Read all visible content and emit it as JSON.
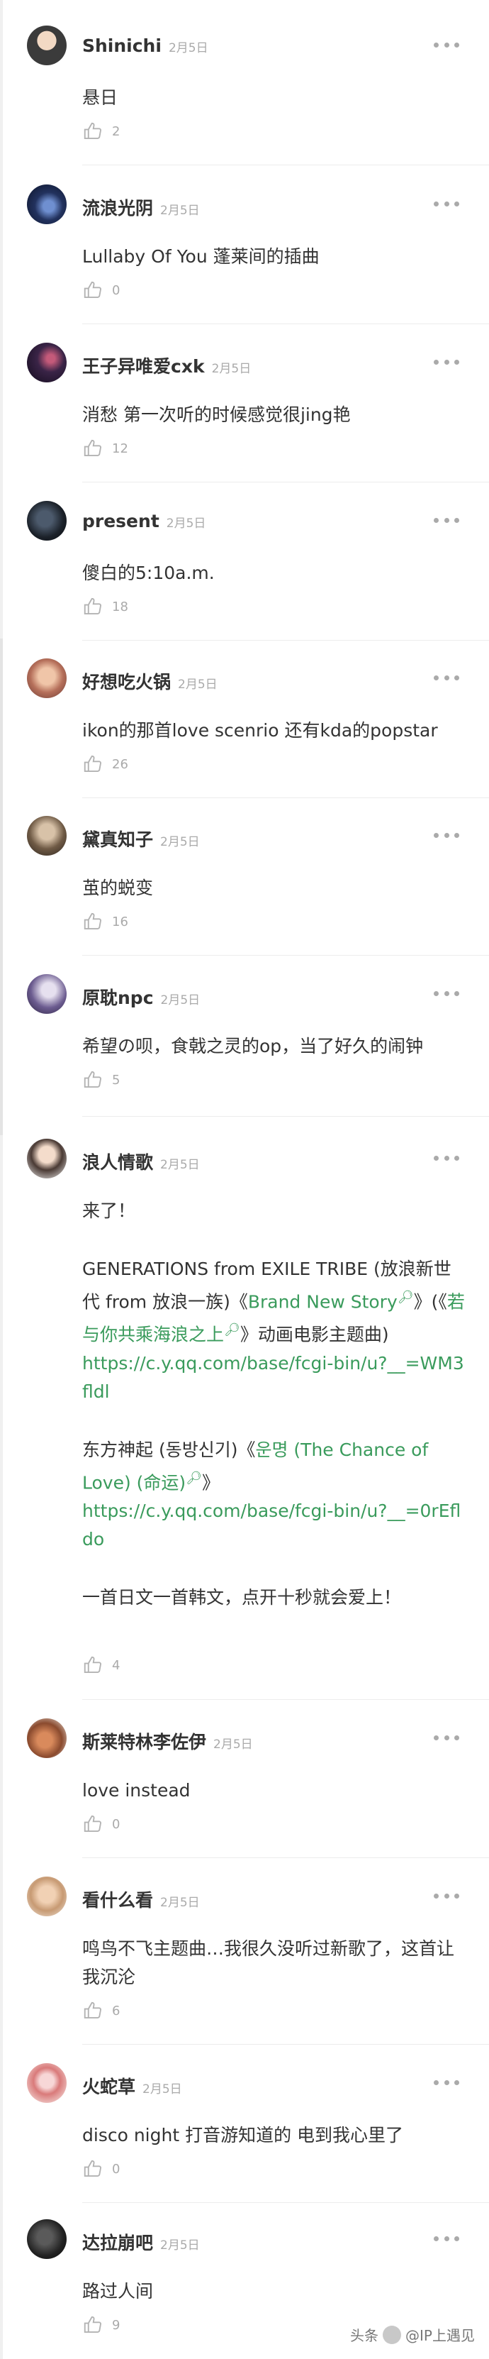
{
  "comments": [
    {
      "user": "Shinichi",
      "date": "2月5日",
      "text": [
        "悬日"
      ],
      "likes": "2"
    },
    {
      "user": "流浪光阴",
      "date": "2月5日",
      "text": [
        "Lullaby Of You  蓬莱间的插曲"
      ],
      "likes": "0"
    },
    {
      "user": "王子异唯爱cxk",
      "date": "2月5日",
      "text": [
        "消愁 第一次听的时候感觉很jing艳"
      ],
      "likes": "12"
    },
    {
      "user": "present",
      "date": "2月5日",
      "text": [
        "傻白的5:10a.m."
      ],
      "likes": "18"
    },
    {
      "user": "好想吃火锅",
      "date": "2月5日",
      "text": [
        "ikon的那首love scenrio  还有kda的popstar"
      ],
      "likes": "26"
    },
    {
      "user": "黛真知子",
      "date": "2月5日",
      "text": [
        "茧的蜕变"
      ],
      "likes": "16"
    },
    {
      "user": "原耽npc",
      "date": "2月5日",
      "text": [
        "希望の呗，食戟之灵的op，当了好久的闹钟"
      ],
      "likes": "5"
    },
    {
      "user": "浪人情歌",
      "date": "2月5日",
      "text": [],
      "likes": "4"
    },
    {
      "user": "斯莱特林李佐伊",
      "date": "2月5日",
      "text": [
        "love instead"
      ],
      "likes": "0"
    },
    {
      "user": "看什么看",
      "date": "2月5日",
      "text": [
        "鸣鸟不飞主题曲…我很久没听过新歌了，这首让我沉沦"
      ],
      "likes": "6"
    },
    {
      "user": "火蛇草",
      "date": "2月5日",
      "text": [
        "disco night 打音游知道的 电到我心里了"
      ],
      "likes": "0"
    },
    {
      "user": "达拉崩吧",
      "date": "2月5日",
      "text": [
        "路过人间"
      ],
      "likes": "9"
    }
  ],
  "rich": {
    "line1": "来了！",
    "p2_pre": "GENERATIONS from EXILE TRIBE (放浪新世代 from 放浪一族)《",
    "p2_song": "Brand New Story",
    "p2_mid": "》(《",
    "p2_anime": "若与你共乘海浪之上",
    "p2_post": "》动画电影主题曲)",
    "p2_url": "https://c.y.qq.com/base/fcgi-bin/u?__=WM3fldl",
    "p3_pre": "东方神起 (동방신기)《",
    "p3_song": "운명 (The Chance of Love) (命运)",
    "p3_post": "》",
    "p3_url": "https://c.y.qq.com/base/fcgi-bin/u?__=0rEfldo",
    "p4": "一首日文一首韩文，点开十秒就会爱上！"
  },
  "watermark": {
    "left": "头条",
    "right": "@IP上遇见"
  },
  "colors": {
    "accent": "#3a9b5c",
    "meta": "#aaaaaa"
  }
}
